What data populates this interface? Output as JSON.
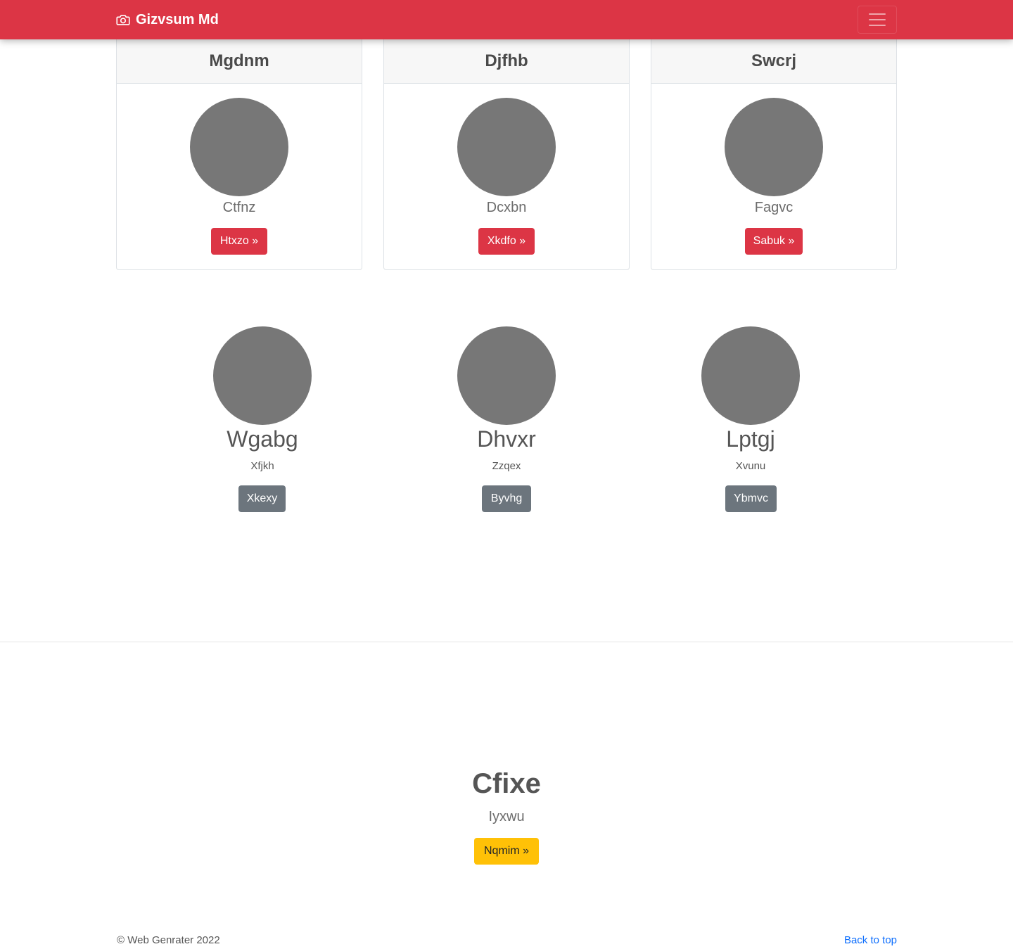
{
  "navbar": {
    "brand": "Gizvsum Md",
    "brand_icon": "camera-icon",
    "toggler_icon": "hamburger-icon",
    "color": "#dc3545"
  },
  "cards": [
    {
      "header": "Mgdnm",
      "subtitle": "Ctfnz",
      "button": "Htxzo »"
    },
    {
      "header": "Djfhb",
      "subtitle": "Dcxbn",
      "button": "Xkdfo »"
    },
    {
      "header": "Swcrj",
      "subtitle": "Fagvc",
      "button": "Sabuk »"
    }
  ],
  "people": [
    {
      "name": "Wgabg",
      "subtitle": "Xfjkh",
      "button": "Xkexy"
    },
    {
      "name": "Dhvxr",
      "subtitle": "Zzqex",
      "button": "Byvhg"
    },
    {
      "name": "Lptgj",
      "subtitle": "Xvunu",
      "button": "Ybmvc"
    }
  ],
  "hero": {
    "title": "Cfixe",
    "subtitle": "Iyxwu",
    "button": "Nqmim »"
  },
  "footer": {
    "copyright": "© Web Genrater 2022",
    "back_to_top": "Back to top"
  }
}
